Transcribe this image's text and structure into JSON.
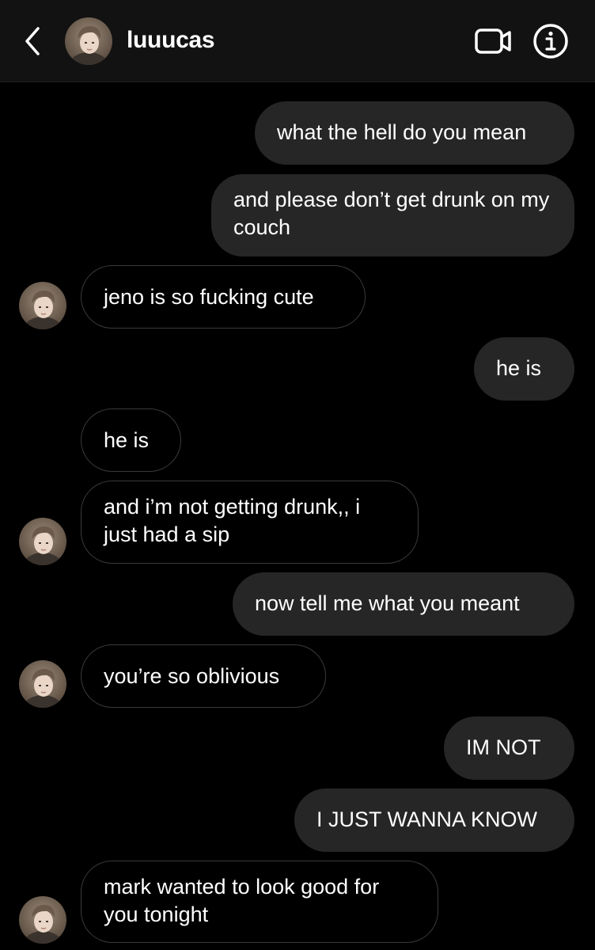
{
  "header": {
    "username": "luuucas",
    "back_icon": "chevron-left-icon",
    "video_icon": "video-camera-icon",
    "info_icon": "info-icon"
  },
  "colors": {
    "background": "#000000",
    "header_bg": "#121212",
    "outgoing_bubble": "#262626",
    "incoming_border": "#3a3a3a",
    "text": "#ffffff"
  },
  "messages": [
    {
      "direction": "outgoing",
      "text": "what the hell do you mean"
    },
    {
      "direction": "outgoing",
      "text": "and please don’t get drunk on my couch"
    },
    {
      "direction": "incoming",
      "text": "jeno is so fucking cute"
    },
    {
      "direction": "outgoing",
      "text": "he is"
    },
    {
      "direction": "incoming",
      "text": "he is"
    },
    {
      "direction": "incoming",
      "text": "and i’m not getting drunk,, i just had a sip"
    },
    {
      "direction": "outgoing",
      "text": "now tell me what you meant"
    },
    {
      "direction": "incoming",
      "text": "you’re so oblivious"
    },
    {
      "direction": "outgoing",
      "text": "IM NOT"
    },
    {
      "direction": "outgoing",
      "text": "I JUST WANNA KNOW"
    },
    {
      "direction": "incoming",
      "text": "mark wanted to look good for you tonight"
    }
  ]
}
